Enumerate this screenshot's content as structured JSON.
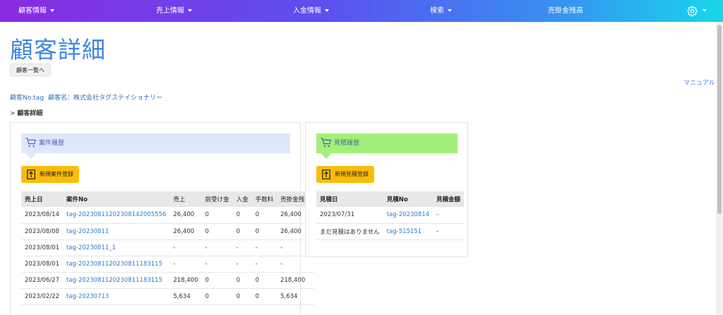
{
  "nav": {
    "items": [
      {
        "label": "顧客情報",
        "caret": true
      },
      {
        "label": "売上情報",
        "caret": true
      },
      {
        "label": "入金情報",
        "caret": true
      },
      {
        "label": "検索",
        "caret": true
      },
      {
        "label": "売掛金残高",
        "caret": false
      }
    ],
    "settings_icon": "gear-icon"
  },
  "page": {
    "title": "顧客詳細",
    "back_button": "顧客一覧へ",
    "manual_link": "マニュアル",
    "customer_no": "顧客No:tag",
    "customer_name": "顧客名：株式会社タグステイショナリー",
    "breadcrumb_prefix": ">",
    "breadcrumb_label": "顧客詳細"
  },
  "orders_panel": {
    "title": "案件履歴",
    "header_color": "#dde9fb",
    "icon": "cart-icon",
    "register_button": "新規案件登録",
    "columns": [
      "売上日",
      "案件No",
      "売上",
      "前受け金",
      "入金",
      "手数料",
      "売掛金残高"
    ],
    "rows": [
      [
        "2023/08/14",
        "tag-20230811202308142005556",
        "26,400",
        "0",
        "0",
        "0",
        "26,400"
      ],
      [
        "2023/08/08",
        "tag-20230811",
        "26,400",
        "0",
        "0",
        "0",
        "26,400"
      ],
      [
        "2023/08/01",
        "tag-20230811_1",
        "-",
        "-",
        "-",
        "-",
        "-"
      ],
      [
        "2023/08/01",
        "tag-202308112023081118311​5",
        "-",
        "-",
        "-",
        "-",
        "-"
      ],
      [
        "2023/06/27",
        "tag-2023081120230811183115",
        "218,400",
        "0",
        "0",
        "0",
        "218,400"
      ],
      [
        "2023/02/22",
        "tag-20230713",
        "5,634",
        "0",
        "0",
        "0",
        "5,634"
      ]
    ]
  },
  "estimates_panel": {
    "title": "見積履歴",
    "header_color": "#a3ef7a",
    "icon": "cart-icon",
    "register_button": "新規見積登録",
    "columns": [
      "見積日",
      "見積No",
      "見積金額"
    ],
    "rows": [
      [
        "2023/07/31",
        "tag-20230814",
        "-"
      ],
      [
        "まだ見積はありません",
        "tag-515151",
        "-"
      ]
    ]
  }
}
